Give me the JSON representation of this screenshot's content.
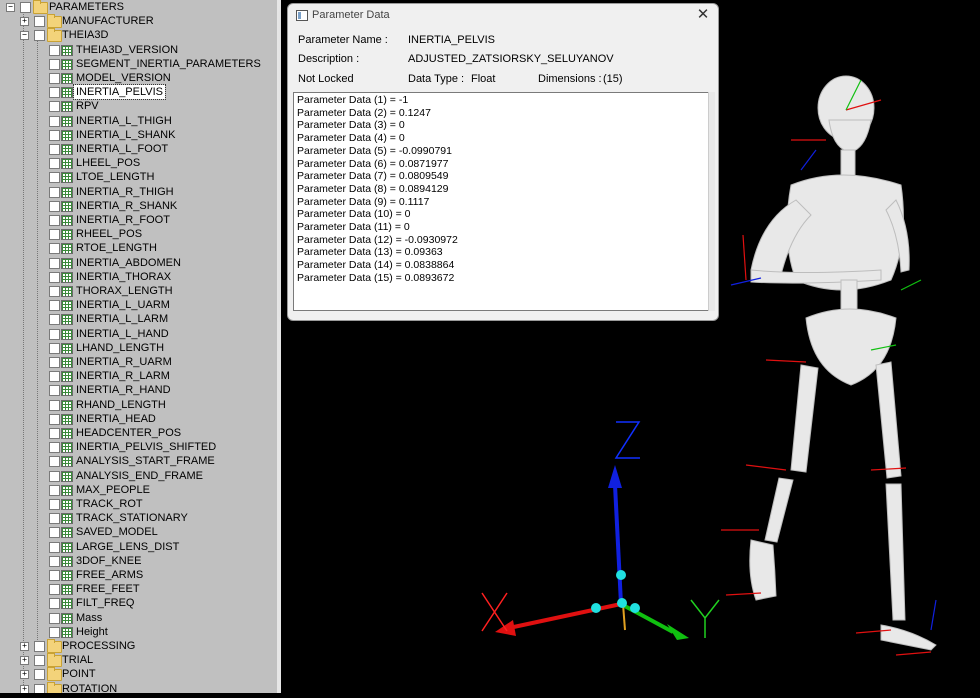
{
  "tree": {
    "root": {
      "label": "PARAMETERS",
      "expander": "−"
    },
    "items": [
      {
        "label": "MANUFACTURER",
        "type": "folder",
        "expander": "+"
      },
      {
        "label": "THEIA3D",
        "type": "folder",
        "expander": "−"
      },
      {
        "label": "THEIA3D_VERSION",
        "type": "grid"
      },
      {
        "label": "SEGMENT_INERTIA_PARAMETERS",
        "type": "grid"
      },
      {
        "label": "MODEL_VERSION",
        "type": "grid"
      },
      {
        "label": "INERTIA_PELVIS",
        "type": "grid",
        "selected": true
      },
      {
        "label": "RPV",
        "type": "grid"
      },
      {
        "label": "INERTIA_L_THIGH",
        "type": "grid"
      },
      {
        "label": "INERTIA_L_SHANK",
        "type": "grid"
      },
      {
        "label": "INERTIA_L_FOOT",
        "type": "grid"
      },
      {
        "label": "LHEEL_POS",
        "type": "grid"
      },
      {
        "label": "LTOE_LENGTH",
        "type": "grid"
      },
      {
        "label": "INERTIA_R_THIGH",
        "type": "grid"
      },
      {
        "label": "INERTIA_R_SHANK",
        "type": "grid"
      },
      {
        "label": "INERTIA_R_FOOT",
        "type": "grid"
      },
      {
        "label": "RHEEL_POS",
        "type": "grid"
      },
      {
        "label": "RTOE_LENGTH",
        "type": "grid"
      },
      {
        "label": "INERTIA_ABDOMEN",
        "type": "grid"
      },
      {
        "label": "INERTIA_THORAX",
        "type": "grid"
      },
      {
        "label": "THORAX_LENGTH",
        "type": "grid"
      },
      {
        "label": "INERTIA_L_UARM",
        "type": "grid"
      },
      {
        "label": "INERTIA_L_LARM",
        "type": "grid"
      },
      {
        "label": "INERTIA_L_HAND",
        "type": "grid"
      },
      {
        "label": "LHAND_LENGTH",
        "type": "grid"
      },
      {
        "label": "INERTIA_R_UARM",
        "type": "grid"
      },
      {
        "label": "INERTIA_R_LARM",
        "type": "grid"
      },
      {
        "label": "INERTIA_R_HAND",
        "type": "grid"
      },
      {
        "label": "RHAND_LENGTH",
        "type": "grid"
      },
      {
        "label": "INERTIA_HEAD",
        "type": "grid"
      },
      {
        "label": "HEADCENTER_POS",
        "type": "grid"
      },
      {
        "label": "INERTIA_PELVIS_SHIFTED",
        "type": "grid"
      },
      {
        "label": "ANALYSIS_START_FRAME",
        "type": "grid"
      },
      {
        "label": "ANALYSIS_END_FRAME",
        "type": "grid"
      },
      {
        "label": "MAX_PEOPLE",
        "type": "grid"
      },
      {
        "label": "TRACK_ROT",
        "type": "grid"
      },
      {
        "label": "TRACK_STATIONARY",
        "type": "grid"
      },
      {
        "label": "SAVED_MODEL",
        "type": "grid"
      },
      {
        "label": "LARGE_LENS_DIST",
        "type": "grid"
      },
      {
        "label": "3DOF_KNEE",
        "type": "grid"
      },
      {
        "label": "FREE_ARMS",
        "type": "grid"
      },
      {
        "label": "FREE_FEET",
        "type": "grid"
      },
      {
        "label": "FILT_FREQ",
        "type": "grid"
      },
      {
        "label": "Mass",
        "type": "grid"
      },
      {
        "label": "Height",
        "type": "grid"
      },
      {
        "label": "PROCESSING",
        "type": "folder",
        "expander": "+"
      },
      {
        "label": "TRIAL",
        "type": "folder",
        "expander": "+"
      },
      {
        "label": "POINT",
        "type": "folder",
        "expander": "+"
      },
      {
        "label": "ROTATION",
        "type": "folder",
        "expander": "+"
      }
    ]
  },
  "dialog": {
    "title": "Parameter Data",
    "close_glyph": "✕",
    "name_label": "Parameter Name :",
    "name_value": "INERTIA_PELVIS",
    "desc_label": "Description :",
    "desc_value": "ADJUSTED_ZATSIORSKY_SELUYANOV",
    "lock_status": "Not Locked",
    "type_label": "Data Type :",
    "type_value": "Float",
    "dim_label": "Dimensions :",
    "dim_value": "(15)",
    "lines": [
      "Parameter Data (1) = -1",
      "Parameter Data (2) = 0.1247",
      "Parameter Data (3) = 0",
      "Parameter Data (4) = 0",
      "Parameter Data (5) = -0.0990791",
      "Parameter Data (6) = 0.0871977",
      "Parameter Data (7) = 0.0809549",
      "Parameter Data (8) = 0.0894129",
      "Parameter Data (9) = 0.1117",
      "Parameter Data (10) = 0",
      "Parameter Data (11) = 0",
      "Parameter Data (12) = -0.0930972",
      "Parameter Data (13) = 0.09363",
      "Parameter Data (14) = 0.0838864",
      "Parameter Data (15) = 0.0893672"
    ]
  },
  "view": {
    "axis_z": "Z",
    "axis_x": "X",
    "axis_y": "Y",
    "colors": {
      "x": "#e01010",
      "y": "#10c010",
      "z": "#1020e0",
      "joint": "#20e0e0",
      "bone": "#e6e6e6"
    }
  }
}
